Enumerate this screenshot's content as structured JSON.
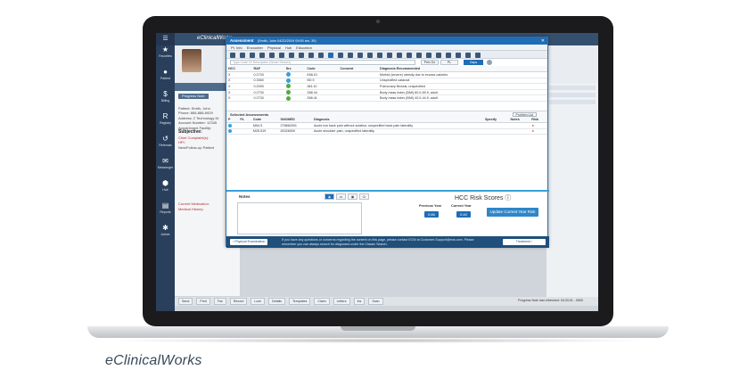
{
  "brand": "eClinicalWorks",
  "app": {
    "logo": "eClinicalWorks"
  },
  "sidebar": {
    "items": [
      {
        "label": "Favorites",
        "icon": "star-icon",
        "glyph": "★"
      },
      {
        "label": "Patient",
        "icon": "person-icon",
        "glyph": "●"
      },
      {
        "label": "Billing",
        "icon": "dollar-icon",
        "glyph": "$"
      },
      {
        "label": "Registry",
        "icon": "registry-icon",
        "glyph": "R"
      },
      {
        "label": "Referrals",
        "icon": "referral-icon",
        "glyph": "↺"
      },
      {
        "label": "Messenger",
        "icon": "chat-icon",
        "glyph": "✉"
      },
      {
        "label": "Hub",
        "icon": "hub-icon",
        "glyph": "⬢"
      },
      {
        "label": "Reports",
        "icon": "reports-icon",
        "glyph": "▤"
      },
      {
        "label": "Admin",
        "icon": "gear-icon",
        "glyph": "✱"
      }
    ]
  },
  "left": {
    "tab": "Progress Note",
    "patient": "Patient: Smith, John",
    "phone": "Phone: 866-888-6929",
    "address": "Address: 2 Technology Dr",
    "account": "Account Number: 12345",
    "facility": "Appointment Facility:",
    "subjective": "Subjective:",
    "chief": "Chief Complaint(s):",
    "hpi": "HPI:",
    "followup": "New/Follow-up Patient",
    "medication": "Current Medication:",
    "history": "Medical History:"
  },
  "modal": {
    "title": "Assessment",
    "subtitle": "(Smith, John 04/22/2019 09:50 am, 39)",
    "menu": [
      "Pt. Info",
      "Encounter",
      "Physical",
      "Hub",
      "Education"
    ],
    "search_placeholder": "Type Code Or Description [Smart Search]",
    "prev_dx": "Prev Dx",
    "pl": "PL",
    "gaps": "Gaps",
    "hcc_columns": [
      "HCC",
      "RAF",
      "Src",
      "Code",
      "Consent",
      "Diagnosis Recommended"
    ],
    "hcc_rows": [
      {
        "hcc": "X",
        "raf": "0.2730",
        "src": "blue",
        "code": "E66.01",
        "diag": "Morbid (severe) obesity due to excess calories"
      },
      {
        "hcc": "X",
        "raf": "0.3060",
        "src": "blue",
        "code": "I50.9",
        "diag": "Unspecified cataract"
      },
      {
        "hcc": "X",
        "raf": "0.2090",
        "src": "green",
        "code": "J84.10",
        "diag": "Pulmonary fibrosis, unspecified"
      },
      {
        "hcc": "X",
        "raf": "0.2730",
        "src": "green",
        "code": "Z68.44",
        "diag": "Body mass index (BMI) 60.0-69.9, adult"
      },
      {
        "hcc": "X",
        "raf": "0.2730",
        "src": "green",
        "code": "Z68.41",
        "diag": "Body mass index (BMI) 40.0-44.9, adult"
      }
    ],
    "selected_title": "Selected Assessments",
    "problem_list": "Problem List",
    "sel_columns": [
      "P",
      "PL",
      "Code",
      "SNOMED",
      "Diagnosis",
      "Specify",
      "Notes",
      "Risk"
    ],
    "sel_rows": [
      {
        "code": "M54.5",
        "snomed": "278862001",
        "diag": "Acute low back pain without sciatica, unspecified back pain laterality"
      },
      {
        "code": "M25.519",
        "snomed": "45326000",
        "diag": "Acute shoulder pain, unspecified laterality"
      }
    ],
    "notes_label": "Notes",
    "notes_btn": "Cr",
    "hcc_title": "HCC Risk Scores ⓘ",
    "prev_year_label": "Previous Year",
    "curr_year_label": "Current Year",
    "prev_year_value": "0.86",
    "curr_year_value": "0.40",
    "update_btn": "Update Current Year Risk",
    "back_btn": "‹ Physical Examination",
    "footer_msg": "If you have any questions or concerns regarding the content on this page, please contact ECW at Customer-Support@ecw.com. Please remember you can always search for diagnoses under the Classic Search.",
    "next_btn": "Treatment ›"
  },
  "footer": {
    "buttons": [
      "Send",
      "Print",
      "Fax",
      "Record",
      "Lock",
      "Details",
      "Templates",
      "Claim",
      "Letters",
      "Ins",
      "Scan"
    ],
    "status": "Progress Note last refreshed: 04:33:01 - 0500"
  }
}
